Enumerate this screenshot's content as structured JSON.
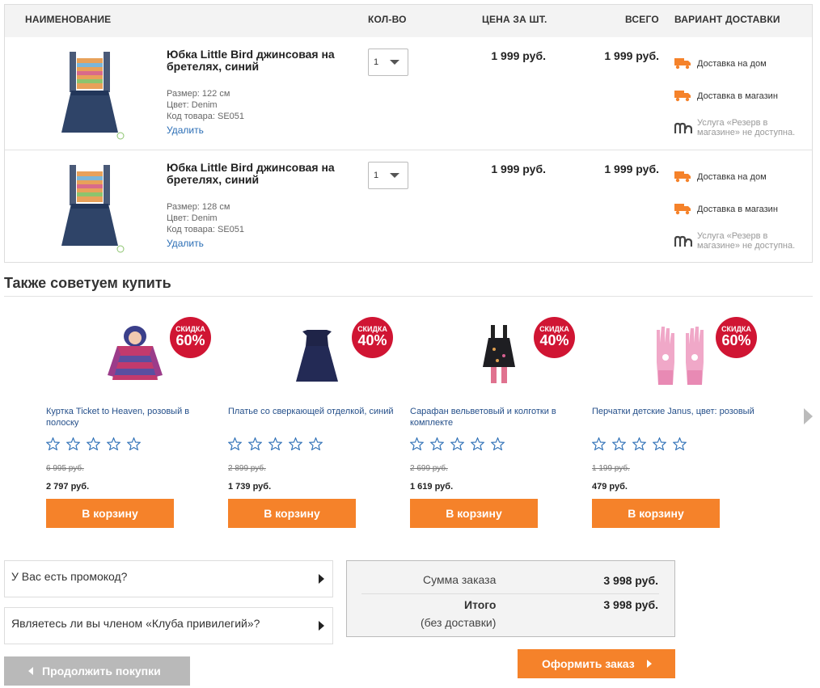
{
  "header": {
    "name": "НАИМЕНОВАНИЕ",
    "qty": "КОЛ-ВО",
    "unit_price": "ЦЕНА ЗА ШТ.",
    "total": "ВСЕГО",
    "delivery": "ВАРИАНТ ДОСТАВКИ"
  },
  "items": [
    {
      "name": "Юбка Little Bird джинсовая на бретелях, синий",
      "size": "Размер:  122 см",
      "color": "Цвет: Denim",
      "code": "Код товара: SE051",
      "remove": "Удалить",
      "qty": "1",
      "unit_price": "1 999 руб.",
      "total": "1 999 руб.",
      "delivery": [
        "Доставка на дом",
        "Доставка в магазин",
        "Услуга «Резерв в магазине» не доступна."
      ]
    },
    {
      "name": "Юбка Little Bird джинсовая на бретелях, синий",
      "size": "Размер:  128 см",
      "color": "Цвет: Denim",
      "code": "Код товара: SE051",
      "remove": "Удалить",
      "qty": "1",
      "unit_price": "1 999 руб.",
      "total": "1 999 руб.",
      "delivery": [
        "Доставка на дом",
        "Доставка в магазин",
        "Услуга «Резерв в магазине» не доступна."
      ]
    }
  ],
  "recommend": {
    "title": "Также советуем купить",
    "badge_label": "СКИДКА",
    "add_label": "В корзину",
    "products": [
      {
        "name": "Куртка Ticket to Heaven, розовый в полоску",
        "discount": "60%",
        "old_price": "6 995 руб.",
        "price": "2 797 руб.",
        "icon": "jacket-image"
      },
      {
        "name": "Платье со сверкающей отделкой, синий",
        "discount": "40%",
        "old_price": "2 899 руб.",
        "price": "1 739 руб.",
        "icon": "dress-image"
      },
      {
        "name": "Сарафан вельветовый и колготки в комплекте",
        "discount": "40%",
        "old_price": "2 699 руб.",
        "price": "1 619 руб.",
        "icon": "pinafore-image"
      },
      {
        "name": "Перчатки детские Janus, цвет: розовый",
        "discount": "60%",
        "old_price": "1 199 руб.",
        "price": "479 руб.",
        "icon": "gloves-image"
      }
    ]
  },
  "promo": {
    "label": "У Вас есть промокод?"
  },
  "club": {
    "label": "Являетесь ли вы членом «Клуба привилегий»?"
  },
  "summary": {
    "sum_label": "Сумма заказа",
    "sum_value": "3 998 руб.",
    "total_label": "Итого",
    "total_value": "3 998 руб.",
    "note": "(без доставки)"
  },
  "buttons": {
    "continue": "Продолжить покупки",
    "checkout": "Оформить заказ"
  },
  "colors": {
    "accent": "#f5822a",
    "badge": "#d01533",
    "link": "#2a6db5"
  }
}
